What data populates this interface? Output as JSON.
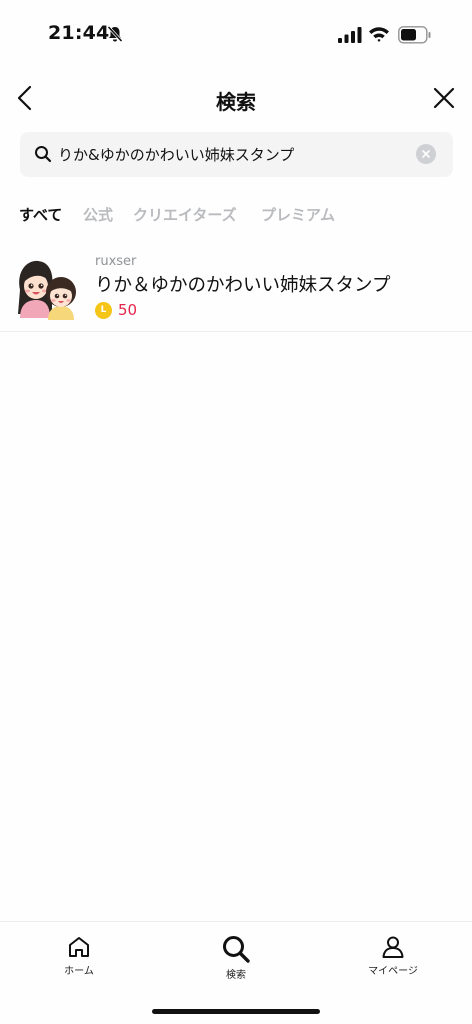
{
  "status_bar": {
    "time": "21:44"
  },
  "nav": {
    "title": "検索"
  },
  "search": {
    "value": "りか&ゆかのかわいい姉妹スタンプ",
    "placeholder": ""
  },
  "tabs": [
    {
      "label": "すべて",
      "active": true
    },
    {
      "label": "公式",
      "active": false
    },
    {
      "label": "クリエイターズ",
      "active": false
    },
    {
      "label": "プレミアム",
      "active": false
    }
  ],
  "results": [
    {
      "author": "ruxser",
      "title": "りか＆ゆかのかわいい姉妹スタンプ",
      "coin_icon": "line-coin-icon",
      "price": "50"
    }
  ],
  "tab_bar": {
    "items": [
      {
        "label": "ホーム",
        "icon": "home-icon"
      },
      {
        "label": "検索",
        "icon": "search-icon"
      },
      {
        "label": "マイページ",
        "icon": "person-icon"
      }
    ]
  },
  "colors": {
    "price": "#e4244a",
    "coin": "#f5c518",
    "inactive_tab": "#b9bbbe",
    "search_bg": "#f4f4f5"
  }
}
